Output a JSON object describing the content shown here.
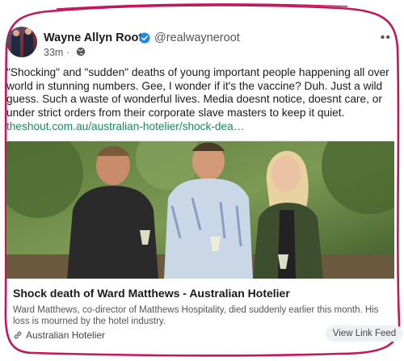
{
  "post": {
    "author_name": "Wayne Allyn Root",
    "handle": "@realwayneroot",
    "time": "33m",
    "separator": "·",
    "body": "\"Shocking\" and \"sudden\" deaths of young important people happening all over world in stunning numbers. Gee, I wonder if it's the vaccine? Duh. Just a wild guess. Such a waste of wonderful lives. Media doesnt notice, doesnt care, or under strict orders from their corporate slave masters to keep it quiet.",
    "link": "theshout.com.au/australian-hotelier/shock-dea…"
  },
  "card": {
    "title": "Shock death of Ward Matthews - Australian Hotelier",
    "description": "Ward Matthews, co-director of Matthews Hospitality, died suddenly earlier this month. His loss is mourned by the hotel industry.",
    "source": "Australian Hotelier",
    "view_button": "View Link Feed"
  },
  "icons": {
    "verified": "verified-badge-icon",
    "globe": "globe-icon",
    "more": "more-options-icon",
    "link": "link-icon"
  },
  "colors": {
    "verified_blue": "#1d8ae0",
    "link_green": "#1a8a5a",
    "frame_magenta": "#c2185b"
  }
}
